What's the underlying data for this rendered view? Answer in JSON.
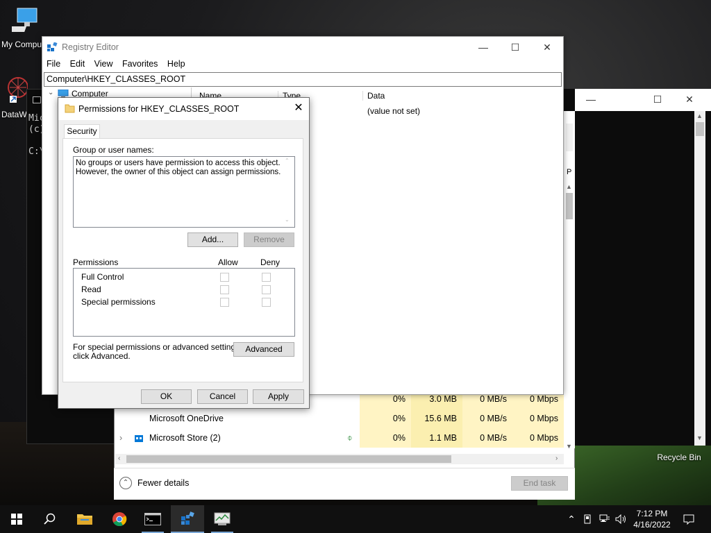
{
  "desktop": {
    "icons": [
      {
        "label": "My Compu"
      },
      {
        "label": "DataW"
      },
      {
        "label": "Recycle Bin"
      }
    ]
  },
  "cmd": {
    "lines": [
      "Mic",
      "(c)",
      "C:\\"
    ]
  },
  "task_manager": {
    "rows": [
      {
        "name": "",
        "cpu": "0%",
        "memory": "3.0 MB",
        "disk": "0 MB/s",
        "network": "0 Mbps"
      },
      {
        "name": "Microsoft OneDrive",
        "cpu": "0%",
        "memory": "15.6 MB",
        "disk": "0 MB/s",
        "network": "0 Mbps"
      },
      {
        "name": "Microsoft Store (2)",
        "cpu": "0%",
        "memory": "1.1 MB",
        "disk": "0 MB/s",
        "network": "0 Mbps"
      }
    ],
    "partial_header": "P",
    "fewer_details": "Fewer details",
    "end_task": "End task"
  },
  "registry": {
    "title": "Registry Editor",
    "menu": [
      "File",
      "Edit",
      "View",
      "Favorites",
      "Help"
    ],
    "address": "Computer\\HKEY_CLASSES_ROOT",
    "tree_root": "Computer",
    "columns": [
      "Name",
      "Type",
      "Data"
    ],
    "value_data": "(value not set)"
  },
  "dialog": {
    "title": "Permissions for HKEY_CLASSES_ROOT",
    "tab": "Security",
    "group_label": "Group or user names:",
    "group_message_1": "No groups or users have permission to access this object.",
    "group_message_2": "However, the owner of this object can assign permissions.",
    "add_button": "Add...",
    "remove_button": "Remove",
    "permissions_label": "Permissions",
    "allow_label": "Allow",
    "deny_label": "Deny",
    "permissions": [
      "Full Control",
      "Read",
      "Special permissions"
    ],
    "special_text_1": "For special permissions or advanced settings,",
    "special_text_2": "click Advanced.",
    "advanced_button": "Advanced",
    "ok_button": "OK",
    "cancel_button": "Cancel",
    "apply_button": "Apply"
  },
  "taskbar": {
    "time": "7:12 PM",
    "date": "4/16/2022"
  },
  "colors": {
    "accent": "#0078d7",
    "tm_highlight": "#fff4c4"
  }
}
